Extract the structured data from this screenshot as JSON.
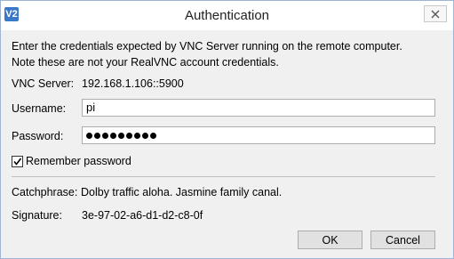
{
  "window": {
    "title": "Authentication",
    "app_icon_text": "V2"
  },
  "intro": {
    "line1": "Enter the credentials expected by VNC Server running on the remote computer.",
    "line2": "Note these are not your RealVNC account credentials."
  },
  "vnc_server": {
    "label": "VNC Server:",
    "value": "192.168.1.106::5900"
  },
  "username": {
    "label": "Username:",
    "value": "pi"
  },
  "password": {
    "label": "Password:",
    "masked_length": 9
  },
  "remember": {
    "label": "Remember password",
    "checked": true
  },
  "catchphrase": {
    "label": "Catchphrase:",
    "value": "Dolby traffic aloha. Jasmine family canal."
  },
  "signature": {
    "label": "Signature:",
    "value": "3e-97-02-a6-d1-d2-c8-0f"
  },
  "buttons": {
    "ok": "OK",
    "cancel": "Cancel"
  },
  "colors": {
    "icon_blue": "#3a78c9",
    "dialog_bg": "#f0f0f0",
    "border": "#9fb5d2"
  }
}
